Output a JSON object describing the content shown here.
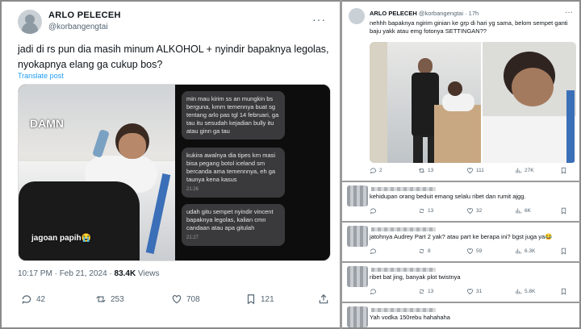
{
  "left_tweet": {
    "display_name": "ARLO PELECEH",
    "handle": "@korbangengtai",
    "text": "jadi di rs pun dia masih minum ALKOHOL + nyindir bapaknya legolas, nyokapnya elang ga cukup bos?",
    "translate": "Translate post",
    "media": {
      "caption_top": "DAMN",
      "caption_bottom": "jagoan papih😭",
      "chat_messages": [
        {
          "text": "min mau kirim ss an mungkin bs berguna, kmrn temennya buat sg tentang arlo pas tgl 14 februari, ga tau itu sesudah kejadian bully itu atau ginn ga tau",
          "time": ""
        },
        {
          "text": "kukira awalnya dia tipes krn masi bisa pegang botol iceland sm bercanda ama temennnya, eh ga taunya kena kasus",
          "time": "21:26"
        },
        {
          "text": "udah gitu sempet nyindir vincent bapaknya legolas, kalian cmn candaan atau apa gitulah",
          "time": "21:27"
        }
      ]
    },
    "time": "10:17 PM · Feb 21, 2024 · ",
    "views_count": "83.4K",
    "views_label": " Views",
    "stats": {
      "replies": "42",
      "reposts": "253",
      "likes": "708",
      "bookmarks": "121"
    }
  },
  "right_tweet": {
    "display_name": "ARLO PELECEH",
    "handle": "@korbangengtai · 17h",
    "text": "nehhh bapaknya ngirim ginian ke grp di hari yg sama, belom sempet ganti baju yakk atau emg fotonya SETTINGAN??",
    "stats": {
      "replies": "2",
      "reposts": "13",
      "likes": "111",
      "views": "27K"
    }
  },
  "replies": [
    {
      "text": "kehidupan orang beduit emang selalu ribet dan rumit ajgg.",
      "replies": "",
      "reposts": "13",
      "likes": "32",
      "views": "6K"
    },
    {
      "text": "jatohnya Audrey Part 2 yak? atau part ke berapa ini? bgst juga ya😂",
      "replies": "",
      "reposts": "8",
      "likes": "59",
      "views": "6.3K"
    },
    {
      "text": "ribet bat jing, banyak plot twistnya",
      "replies": "",
      "reposts": "13",
      "likes": "31",
      "views": "5.8K"
    },
    {
      "text": "Yah vodka 150rebu hahahaha",
      "replies": "",
      "reposts": "",
      "likes": "",
      "views": ""
    }
  ],
  "colors": {
    "link": "#1d9bf0",
    "muted": "#536471",
    "border": "#9a9a9a"
  }
}
